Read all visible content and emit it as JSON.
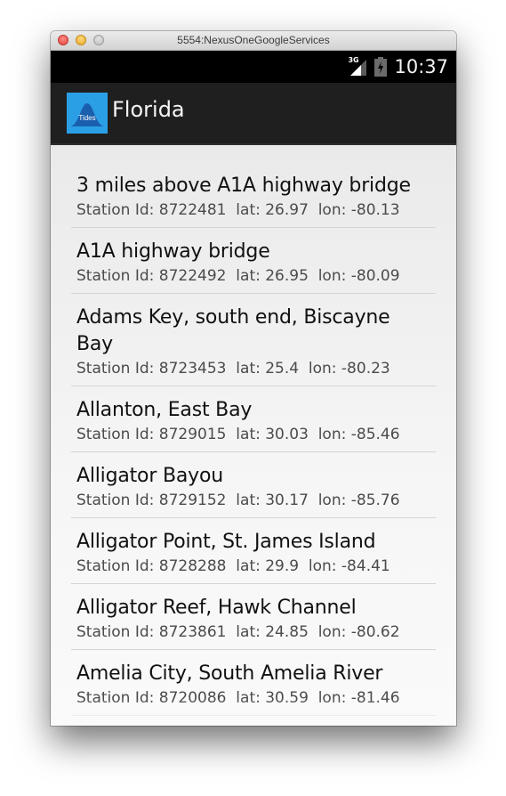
{
  "window": {
    "title": "5554:NexusOneGoogleServices"
  },
  "status_bar": {
    "network": "3G",
    "time": "10:37"
  },
  "action_bar": {
    "app_icon_label": "Tides",
    "title": "Florida",
    "colors": {
      "icon_background": "#2b9fe6",
      "bar_background": "#1f1f1f"
    }
  },
  "stations": [
    {
      "name": "3 miles above A1A highway bridge",
      "meta": "Station Id: 8722481  lat: 26.97  lon: -80.13"
    },
    {
      "name": "A1A highway bridge",
      "meta": "Station Id: 8722492  lat: 26.95  lon: -80.09"
    },
    {
      "name": "Adams Key, south end, Biscayne Bay",
      "meta": "Station Id: 8723453  lat: 25.4  lon: -80.23"
    },
    {
      "name": "Allanton, East Bay",
      "meta": "Station Id: 8729015  lat: 30.03  lon: -85.46"
    },
    {
      "name": "Alligator Bayou",
      "meta": "Station Id: 8729152  lat: 30.17  lon: -85.76"
    },
    {
      "name": "Alligator Point, St. James Island",
      "meta": "Station Id: 8728288  lat: 29.9  lon: -84.41"
    },
    {
      "name": "Alligator Reef, Hawk Channel",
      "meta": "Station Id: 8723861  lat: 24.85  lon: -80.62"
    },
    {
      "name": "Amelia City, South Amelia River",
      "meta": "Station Id: 8720086  lat: 30.59  lon: -81.46"
    }
  ]
}
